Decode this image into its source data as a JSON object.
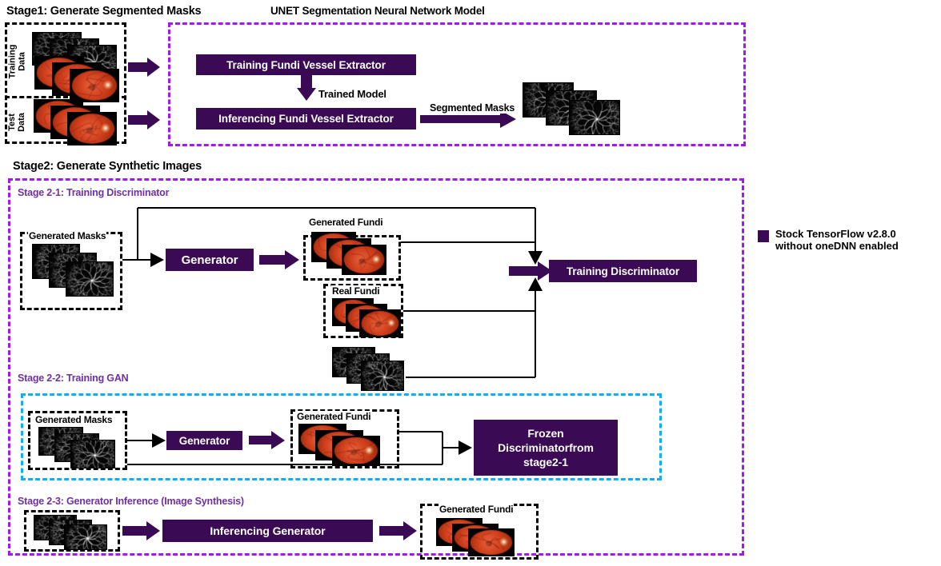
{
  "stage1": {
    "title": "Stage1: Generate Segmented Masks",
    "unet_title": "UNET Segmentation Neural Network Model",
    "training_data_label": "Training\nData",
    "test_data_label": "Test\nData",
    "training_extractor": "Training Fundi Vessel  Extractor",
    "trained_model_label": "Trained Model",
    "inferencing_extractor": "Inferencing Fundi Vessel  Extractor",
    "segmented_masks_label": "Segmented  Masks"
  },
  "stage2": {
    "title": "Stage2: Generate Synthetic Images",
    "sub1": {
      "title": "Stage 2-1: Training Discriminator",
      "generated_masks_label": "Generated Masks",
      "generator_label": "Generator",
      "generated_fundi_label": "Generated Fundi",
      "real_fundi_label": "Real Fundi",
      "training_discriminator_label": "Training Discriminator"
    },
    "sub2": {
      "title": "Stage 2-2: Training GAN",
      "generated_masks_label": "Generated Masks",
      "generator_label": "Generator",
      "generated_fundi_label": "Generated Fundi",
      "frozen_discriminator_label": "Frozen\nDiscriminatorfrom\nstage2-1"
    },
    "sub3": {
      "title": "Stage 2-3: Generator Inference (Image Synthesis)",
      "inferencing_generator_label": "Inferencing Generator",
      "generated_fundi_label": "Generated Fundi"
    }
  },
  "legend": {
    "line1": "Stock TensorFlow v2.8.0",
    "line2": "without oneDNN enabled",
    "swatch_color": "#3A0A55"
  },
  "colors": {
    "purple_dark": "#3A0A55",
    "purple_dashed": "#A01AF0",
    "blue_dashed": "#13AEEF",
    "substage_text": "#7030A0",
    "black": "#000000"
  }
}
